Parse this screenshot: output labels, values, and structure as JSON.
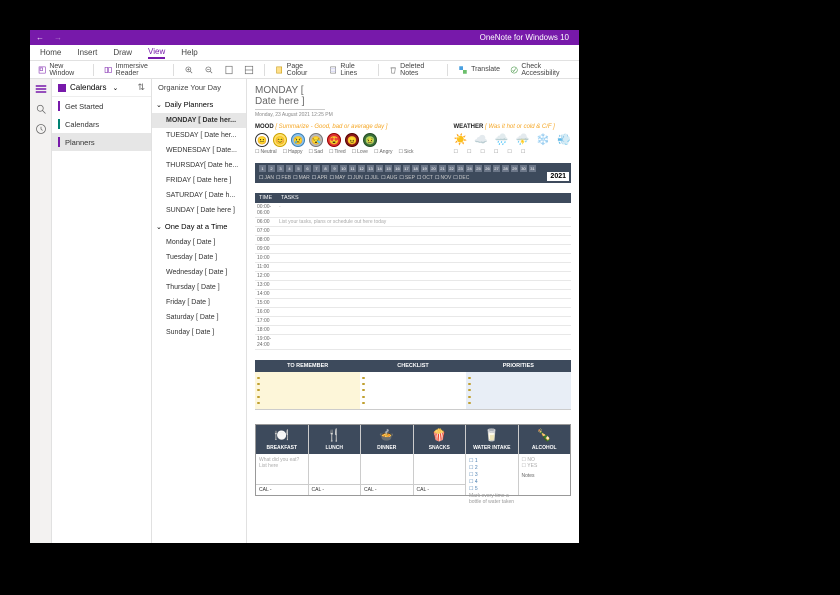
{
  "titlebar": {
    "title": "OneNote for Windows 10"
  },
  "menu": {
    "items": [
      "Home",
      "Insert",
      "Draw",
      "View",
      "Help"
    ],
    "active": 3
  },
  "ribbon": {
    "new_window": "New Window",
    "immersive": "Immersive Reader",
    "page_colour": "Page Colour",
    "rule_lines": "Rule Lines",
    "deleted": "Deleted Notes",
    "translate": "Translate",
    "accessibility": "Check Accessibility"
  },
  "notebook": {
    "name": "Calendars",
    "sections": [
      {
        "label": "Get Started",
        "color": "#7719AA"
      },
      {
        "label": "Calendars",
        "color": "#008272"
      },
      {
        "label": "Planners",
        "color": "#7719AA",
        "selected": true
      }
    ]
  },
  "pages": {
    "top_group": "Organize Your Day",
    "groups": [
      {
        "name": "Daily Planners",
        "expanded": true,
        "pages": [
          "MONDAY [ Date her...",
          "TUESDAY [ Date her...",
          "WEDNESDAY [ Date...",
          "THURSDAY[ Date he...",
          "FRIDAY [ Date here ]",
          "SATURDAY [ Date h...",
          "SUNDAY [ Date here ]"
        ],
        "selected": 0
      },
      {
        "name": "One Day at a Time",
        "expanded": true,
        "pages": [
          "Monday [ Date ]",
          "Tuesday [ Date ]",
          "Wednesday [ Date ]",
          "Thursday [ Date ]",
          "Friday [ Date ]",
          "Saturday [ Date ]",
          "Sunday [ Date ]"
        ]
      }
    ]
  },
  "doc": {
    "title": "MONDAY [ Date here ]",
    "subtitle": "Monday, 23 August 2021    12:25 PM",
    "mood": {
      "label": "MOOD",
      "hint": "[ Summarize - Good, bad or average day ]",
      "options": [
        "Neutral",
        "Happy",
        "Sad",
        "Tired",
        "Love",
        "Angry",
        "Sick"
      ]
    },
    "weather": {
      "label": "WEATHER",
      "hint": "[ Was it hot or cold & C/F ]"
    },
    "months": [
      "JAN",
      "FEB",
      "MAR",
      "APR",
      "MAY",
      "JUN",
      "JUL",
      "AUG",
      "SEP",
      "OCT",
      "NOV",
      "DEC"
    ],
    "year": "2021",
    "sched": {
      "head_time": "TIME",
      "head_tasks": "TASKS",
      "hint": "List your tasks, plans or schedule out here today",
      "rows": [
        "00:00-06:00",
        "06:00",
        "07:00",
        "08:00",
        "09:00",
        "10:00",
        "11:00",
        "12:00",
        "13:00",
        "14:00",
        "15:00",
        "16:00",
        "17:00",
        "18:00",
        "19:00-24:00"
      ]
    },
    "triple": {
      "remember": "TO REMEMBER",
      "checklist": "CHECKLIST",
      "priorities": "PRIORITIES"
    },
    "meals": {
      "cols": [
        {
          "icon": "🍽️",
          "label": "BREAKFAST",
          "hint": "What did you eat? List here",
          "foot": "CAL      -"
        },
        {
          "icon": "🍴",
          "label": "LUNCH",
          "foot": "CAL      -"
        },
        {
          "icon": "🍲",
          "label": "DINNER",
          "foot": "CAL      -"
        },
        {
          "icon": "🍿",
          "label": "SNACKS",
          "foot": "CAL      -"
        },
        {
          "icon": "🥛",
          "label": "WATER INTAKE"
        },
        {
          "icon": "🍾",
          "label": "ALCOHOL"
        }
      ],
      "water_rows": [
        "☐ 1",
        "☐ 2",
        "☐ 3",
        "☐ 4",
        "☐ 5"
      ],
      "water_hint": "Mark every time a bottle of water taken",
      "alc": [
        "☐ NO",
        "☐ YES"
      ],
      "alc_note": "Notes"
    }
  }
}
